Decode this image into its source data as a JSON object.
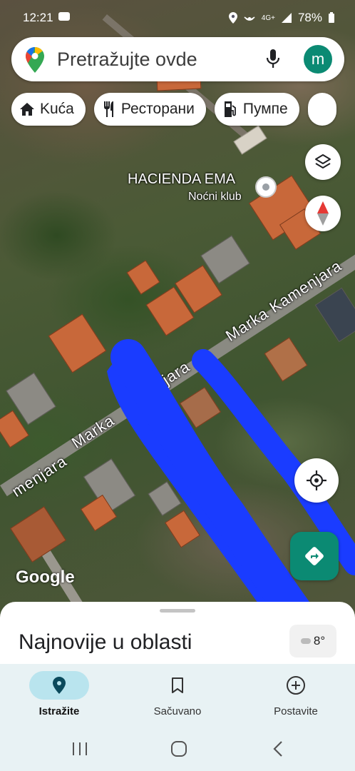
{
  "status_bar": {
    "time": "12:21",
    "battery": "78%",
    "network": "4G+"
  },
  "search": {
    "placeholder": "Pretražujte ovde",
    "avatar_letter": "m"
  },
  "chips": [
    {
      "label": "Kuća",
      "icon": "home-icon"
    },
    {
      "label": "Ресторани",
      "icon": "restaurant-icon"
    },
    {
      "label": "Пумпе",
      "icon": "gas-station-icon"
    }
  ],
  "map": {
    "poi": {
      "name": "HACIENDA EMA",
      "category": "Noćni klub"
    },
    "streets": [
      "Marka Kamenjara",
      "njara",
      "Marka",
      "menjara"
    ],
    "attribution": "Google",
    "accent_blue": "#1a3cff"
  },
  "sheet": {
    "title": "Najnovije u oblasti",
    "weather_temp": "8°"
  },
  "bottom_nav": {
    "items": [
      {
        "label": "Istražite",
        "icon": "explore-pin-icon"
      },
      {
        "label": "Sačuvano",
        "icon": "bookmark-icon"
      },
      {
        "label": "Postavite",
        "icon": "add-circle-icon"
      }
    ]
  }
}
